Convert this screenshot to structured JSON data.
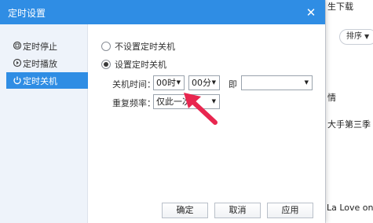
{
  "dialog": {
    "title": "定时设置",
    "close_glyph": "✕",
    "menu": [
      {
        "label": "定时停止",
        "icon": "stop-icon"
      },
      {
        "label": "定时播放",
        "icon": "play-clock-icon"
      },
      {
        "label": "定时关机",
        "icon": "power-icon",
        "active": true
      }
    ],
    "options": {
      "no_shutdown": "不设置定时关机",
      "set_shutdown": "设置定时关机",
      "selected": "set_shutdown"
    },
    "shutdown_time": {
      "label": "关机时间：",
      "hour": "00时",
      "minute": "00分",
      "on_label": "即",
      "date_value": ""
    },
    "repeat": {
      "label": "重复频率：",
      "value": "仅此一次"
    },
    "buttons": {
      "ok": "确定",
      "cancel": "取消",
      "apply": "应用"
    }
  },
  "background": {
    "top_text": "生下载",
    "sort_label": "排序",
    "detail_text": "情",
    "song_text": "大手第三季 第",
    "bottom_text": "La Love on I"
  },
  "colors": {
    "accent": "#2f8de4",
    "annotation_arrow": "#e8264f"
  }
}
